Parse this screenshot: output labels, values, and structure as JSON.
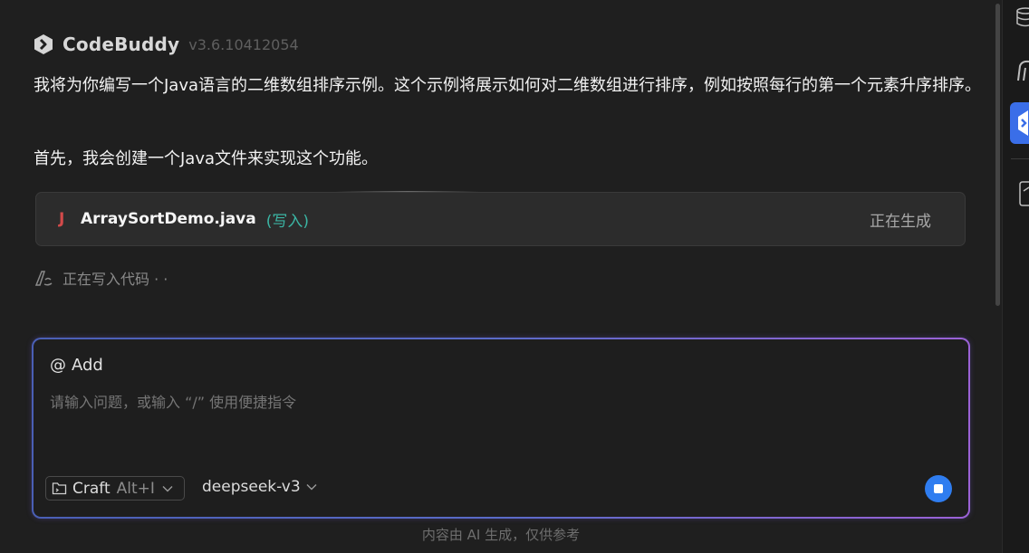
{
  "header": {
    "brand": "CodeBuddy",
    "version": "v3.6.10412054"
  },
  "messages": [
    "我将为你编写一个Java语言的二维数组排序示例。这个示例将展示如何对二维数组进行排序，例如按照每行的第一个元素升序排序。",
    "首先，我会创建一个Java文件来实现这个功能。"
  ],
  "file_card": {
    "icon_letter": "J",
    "file_name": "ArraySortDemo.java",
    "action": "(写入)",
    "status": "正在生成"
  },
  "writing_status": "正在写入代码 · ·",
  "input": {
    "add_label": "Add",
    "placeholder": "请输入问题，或输入 “/” 使用便捷指令",
    "mode_label": "Craft",
    "mode_shortcut": "Alt+I",
    "model_label": "deepseek-v3"
  },
  "footer": "内容由 AI 生成，仅供参考",
  "colors": {
    "accent": "#2f7df0",
    "file_action": "#3bb5a4",
    "java_icon": "#d24a4a"
  },
  "icons": [
    "codebuddy-logo-icon",
    "java-file-icon",
    "writing-pen-icon",
    "at-icon",
    "folder-icon",
    "chevron-down-icon",
    "stop-icon",
    "database-icon",
    "snippet-icon",
    "codebuddy-side-icon",
    "file-icon"
  ]
}
